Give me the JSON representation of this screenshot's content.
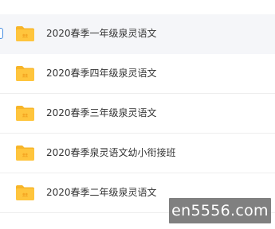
{
  "files": [
    {
      "name": "2020春季一年级泉灵语文",
      "icon": "folder-icon",
      "selected": true
    },
    {
      "name": "2020春季四年级泉灵语文",
      "icon": "folder-icon",
      "selected": false
    },
    {
      "name": "2020春季三年级泉灵语文",
      "icon": "folder-icon",
      "selected": false
    },
    {
      "name": "2020春季泉灵语文幼小衔接班",
      "icon": "folder-icon",
      "selected": false
    },
    {
      "name": "2020春季二年级泉灵语文",
      "icon": "folder-icon",
      "selected": false
    }
  ],
  "watermark": {
    "text": "en5556.com"
  },
  "colors": {
    "folder": "#ffc53d",
    "folder_back": "#f7b529",
    "selected_row_bg": "#f5f6f9",
    "checkbox_border": "#4a90e2",
    "text": "#333333"
  }
}
